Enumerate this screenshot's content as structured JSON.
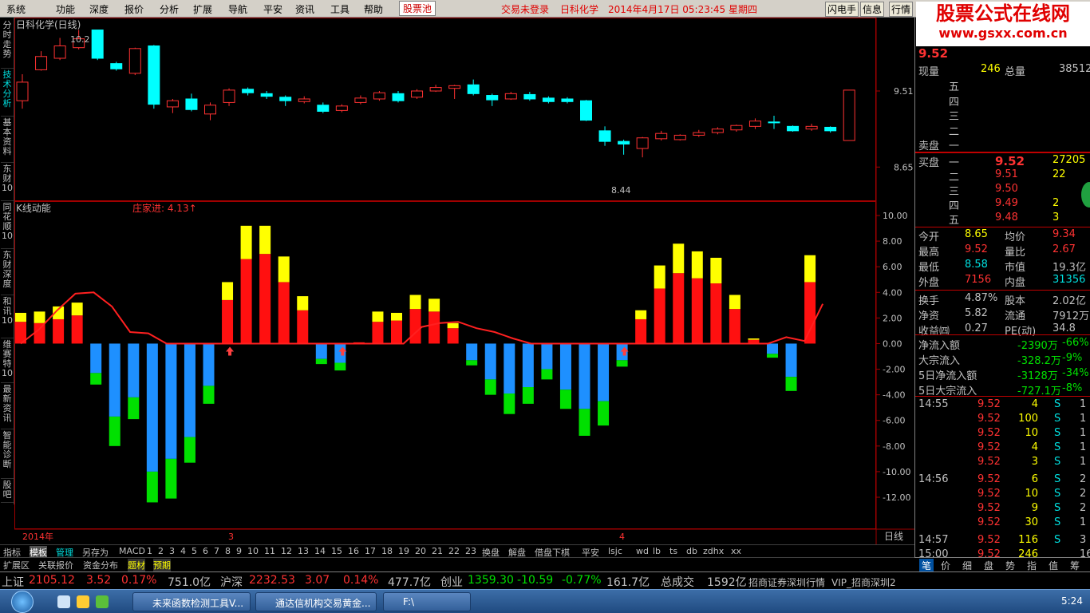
{
  "menu": {
    "items": [
      "系统",
      "功能",
      "深度",
      "报价",
      "分析",
      "扩展",
      "导航",
      "平安",
      "资讯",
      "工具",
      "帮助"
    ],
    "active": "股票池",
    "status_login": "交易未登录",
    "status_name": "日科化学",
    "status_time": "2014年4月17日 05:23:45 星期四",
    "right_buttons": [
      "闪电手",
      "信息",
      "行情"
    ]
  },
  "watermark": {
    "title": "股票公式在线网",
    "url": "www.gsxx.com.cn"
  },
  "side_tabs": [
    "分时走势",
    "技术分析",
    "基本资料",
    "东财10",
    "同花顺10",
    "东财深度",
    "和讯10",
    "维赛特10",
    "最新资讯",
    "智能诊断",
    "股吧"
  ],
  "chart_title": "日科化学(日线)",
  "indicator_title": "K线动能",
  "indicator_note": "庄家进: 4.13↑",
  "high_label": "10.2",
  "low_label": "8.44",
  "price_axis": [
    "9.51",
    "8.65"
  ],
  "ind_axis": [
    "10.00",
    "8.00",
    "6.00",
    "4.00",
    "2.00",
    "0.00",
    "-2.00",
    "-4.00",
    "-6.00",
    "-8.00",
    "-10.00",
    "-12.00"
  ],
  "date_labels": {
    "year": "2014年",
    "m3": "3",
    "m4": "4",
    "period": "日线"
  },
  "candle_colors": {
    "up": "#ff3232",
    "down": "#00ffff"
  },
  "chart_data": {
    "type": "candlestick",
    "title": "日科化学(日线)",
    "candles": [
      [
        9.4,
        9.61,
        9.31,
        9.7
      ],
      [
        9.75,
        9.9,
        9.74,
        9.96
      ],
      [
        9.88,
        10.02,
        9.86,
        10.11
      ],
      [
        10.0,
        10.1,
        9.98,
        10.2
      ],
      [
        10.2,
        9.88,
        9.86,
        10.2
      ],
      [
        9.82,
        9.76,
        9.74,
        9.84
      ],
      [
        9.71,
        9.99,
        9.69,
        10.0
      ],
      [
        10.02,
        9.36,
        9.31,
        10.03
      ],
      [
        9.33,
        9.4,
        9.26,
        9.42
      ],
      [
        9.42,
        9.3,
        9.28,
        9.48
      ],
      [
        9.25,
        9.35,
        9.18,
        9.38
      ],
      [
        9.38,
        9.52,
        9.34,
        9.54
      ],
      [
        9.53,
        9.49,
        9.46,
        9.55
      ],
      [
        9.48,
        9.45,
        9.42,
        9.51
      ],
      [
        9.44,
        9.4,
        9.34,
        9.46
      ],
      [
        9.39,
        9.42,
        9.37,
        9.45
      ],
      [
        9.35,
        9.28,
        9.26,
        9.38
      ],
      [
        9.29,
        9.34,
        9.27,
        9.36
      ],
      [
        9.38,
        9.43,
        9.36,
        9.46
      ],
      [
        9.42,
        9.49,
        9.4,
        9.51
      ],
      [
        9.48,
        9.4,
        9.38,
        9.51
      ],
      [
        9.44,
        9.51,
        9.42,
        9.53
      ],
      [
        9.51,
        9.55,
        9.5,
        9.58
      ],
      [
        9.54,
        9.57,
        9.42,
        9.58
      ],
      [
        9.58,
        9.48,
        9.46,
        9.64
      ],
      [
        9.46,
        9.41,
        9.34,
        9.48
      ],
      [
        9.42,
        9.48,
        9.41,
        9.5
      ],
      [
        9.47,
        9.42,
        9.4,
        9.5
      ],
      [
        9.43,
        9.39,
        9.37,
        9.45
      ],
      [
        9.42,
        9.39,
        9.37,
        9.44
      ],
      [
        9.4,
        9.18,
        9.17,
        9.41
      ],
      [
        9.06,
        8.94,
        8.89,
        9.11
      ],
      [
        8.94,
        8.91,
        8.79,
        8.96
      ],
      [
        8.86,
        8.98,
        8.76,
        8.99
      ],
      [
        8.97,
        9.03,
        8.95,
        9.06
      ],
      [
        8.96,
        9.01,
        8.95,
        9.02
      ],
      [
        9.01,
        9.04,
        8.99,
        9.07
      ],
      [
        9.04,
        9.08,
        9.02,
        9.1
      ],
      [
        9.07,
        9.12,
        9.05,
        9.13
      ],
      [
        9.11,
        9.17,
        9.08,
        9.2
      ],
      [
        9.16,
        9.15,
        9.08,
        9.23
      ],
      [
        9.11,
        9.06,
        9.05,
        9.12
      ],
      [
        9.08,
        9.11,
        9.06,
        9.14
      ],
      [
        9.1,
        9.06,
        9.04,
        9.11
      ],
      [
        8.95,
        9.52,
        8.95,
        9.52
      ]
    ],
    "bars": [
      {
        "r": 1.7,
        "y": 0.7
      },
      {
        "r": 1.6,
        "y": 0.9
      },
      {
        "r": 1.9,
        "y": 1.0
      },
      {
        "r": 2.2,
        "y": 1.0
      },
      {
        "b": -2.3,
        "g": -0.9
      },
      {
        "b": -5.7,
        "g": -2.3
      },
      {
        "b": -4.2,
        "g": -1.7
      },
      {
        "b": -10.0,
        "g": -2.4
      },
      {
        "b": -9.0,
        "g": -3.1
      },
      {
        "b": -7.3,
        "g": -2.0
      },
      {
        "b": -3.3,
        "g": -1.4
      },
      {
        "r": 3.4,
        "y": 1.4
      },
      {
        "r": 6.6,
        "y": 2.6
      },
      {
        "r": 7.0,
        "y": 2.2
      },
      {
        "r": 4.8,
        "y": 2.0
      },
      {
        "r": 2.6,
        "y": 1.1
      },
      {
        "b": -1.2,
        "g": -0.4
      },
      {
        "b": -1.5,
        "g": -0.6
      },
      {
        "r": 0.1,
        "y": 0.0
      },
      {
        "r": 1.7,
        "y": 0.8
      },
      {
        "r": 1.8,
        "y": 0.6
      },
      {
        "r": 2.7,
        "y": 1.1
      },
      {
        "r": 2.5,
        "y": 1.0
      },
      {
        "r": 1.2,
        "y": 0.4
      },
      {
        "b": -1.3,
        "g": -0.4
      },
      {
        "b": -2.8,
        "g": -1.2
      },
      {
        "b": -3.9,
        "g": -1.6
      },
      {
        "b": -3.4,
        "g": -1.3
      },
      {
        "b": -2.0,
        "g": -0.8
      },
      {
        "b": -3.6,
        "g": -1.5
      },
      {
        "b": -5.1,
        "g": -2.1
      },
      {
        "b": -4.5,
        "g": -1.9
      },
      {
        "b": -1.3,
        "g": -0.5
      },
      {
        "r": 1.9,
        "y": 0.7
      },
      {
        "r": 4.3,
        "y": 1.8
      },
      {
        "r": 5.5,
        "y": 2.3
      },
      {
        "r": 5.1,
        "y": 2.1
      },
      {
        "r": 4.7,
        "y": 2.0
      },
      {
        "r": 2.7,
        "y": 1.1
      },
      {
        "r": 0.3,
        "y": 0.1
      },
      {
        "b": -0.8,
        "g": -0.3
      },
      {
        "b": -2.6,
        "g": -1.1
      },
      {
        "r": 4.8,
        "y": 2.1
      }
    ],
    "line": [
      0.0,
      1.1,
      2.6,
      3.9,
      4.0,
      2.9,
      0.9,
      0.8,
      0.0,
      0.0,
      0.0,
      0.0,
      0.0,
      0.0,
      0.0,
      0.0,
      0.0,
      0.0,
      0.0,
      0.0,
      0.0,
      0.0,
      1.3,
      1.6,
      1.7,
      1.2,
      0.9,
      0.4,
      0.0,
      0.0,
      0.0,
      0.0,
      0.0,
      0.0,
      0.0,
      0.0,
      0.0,
      0.0,
      0.0,
      0.0,
      0.0,
      0.0,
      0.5,
      0.2,
      3.1
    ],
    "arrows": [
      11,
      17,
      32
    ]
  },
  "bottom_tabs": [
    "指标",
    "模板",
    "管理",
    "另存为",
    "MACD",
    "1",
    "2",
    "3",
    "4",
    "5",
    "6",
    "7",
    "8",
    "9",
    "10",
    "11",
    "12",
    "13",
    "14",
    "15",
    "16",
    "17",
    "18",
    "19",
    "20",
    "21",
    "22",
    "23",
    "换盘",
    "解盘",
    "借盘下棋",
    "平安",
    "lsjc",
    "wd",
    "lb",
    "ts",
    "db",
    "zdhx",
    "xx"
  ],
  "bottom_tabs2": [
    "扩展区",
    "关联报价",
    "资金分布",
    "题材",
    "预期"
  ],
  "ticker": {
    "sh_label": "上证",
    "sh_val": "2105.12",
    "sh_chg": "3.52",
    "sh_pct": "0.17%",
    "sh_amt": "751.0亿",
    "hs_label": "沪深",
    "hs_val": "2232.53",
    "hs_chg": "3.07",
    "hs_pct": "0.14%",
    "hs_amt": "477.7亿",
    "cy_label": "创业",
    "cy_val": "1359.30",
    "cy_chg": "-10.59",
    "cy_pct": "-0.77%",
    "cy_amt": "161.7亿",
    "total_label": "总成交",
    "total_val": "1592亿",
    "broker": "招商证券深圳行情",
    "vip": "VIP_招商深圳2"
  },
  "right": {
    "price_partial": "9.52",
    "row_xianliang": [
      "现量",
      "246",
      "总量",
      "38512"
    ],
    "sell_title": "卖盘",
    "sell_rows": [
      "五",
      "四",
      "三",
      "二",
      "一"
    ],
    "buy_title": "买盘",
    "buy_rows": [
      [
        "一",
        "9.52",
        "27205"
      ],
      [
        "二",
        "9.51",
        "22"
      ],
      [
        "三",
        "9.50",
        ""
      ],
      [
        "四",
        "9.49",
        "2"
      ],
      [
        "五",
        "9.48",
        "3"
      ]
    ],
    "stats": [
      [
        "今开",
        "8.65",
        "均价",
        "9.34"
      ],
      [
        "最高",
        "9.52",
        "量比",
        "2.67"
      ],
      [
        "最低",
        "8.58",
        "市值",
        "19.3亿"
      ],
      [
        "外盘",
        "7156",
        "内盘",
        "31356"
      ],
      [
        "换手",
        "4.87%",
        "股本",
        "2.02亿"
      ],
      [
        "净资",
        "5.82",
        "流通",
        "7912万"
      ],
      [
        "收益㈣",
        "0.27",
        "PE(动)",
        "34.8"
      ]
    ],
    "flows": [
      [
        "净流入额",
        "-2390万",
        "-66%"
      ],
      [
        "大宗流入",
        "-328.2万",
        "-9%"
      ],
      [
        "5日净流入额",
        "-3128万",
        "-34%"
      ],
      [
        "5日大宗流入",
        "-727.1万",
        "-8%"
      ]
    ],
    "ticks": [
      [
        "14:55",
        "9.52",
        "4",
        "S",
        "1"
      ],
      [
        "",
        "9.52",
        "100",
        "S",
        "1"
      ],
      [
        "",
        "9.52",
        "10",
        "S",
        "1"
      ],
      [
        "",
        "9.52",
        "4",
        "S",
        "1"
      ],
      [
        "",
        "9.52",
        "3",
        "S",
        "1"
      ],
      [
        "14:56",
        "9.52",
        "6",
        "S",
        "2"
      ],
      [
        "",
        "9.52",
        "10",
        "S",
        "2"
      ],
      [
        "",
        "9.52",
        "9",
        "S",
        "2"
      ],
      [
        "",
        "9.52",
        "30",
        "S",
        "1"
      ],
      [
        "14:57",
        "9.52",
        "116",
        "S",
        "3"
      ],
      [
        "15:00",
        "9.52",
        "246",
        "",
        "16"
      ]
    ],
    "tabs": [
      "笔",
      "价",
      "细",
      "盘",
      "势",
      "指",
      "值",
      "筹"
    ]
  },
  "taskbar": {
    "items": [
      "未来函数检测工具V...",
      "通达信机构交易黄金...",
      "F:\\"
    ],
    "clock": "5:24"
  }
}
